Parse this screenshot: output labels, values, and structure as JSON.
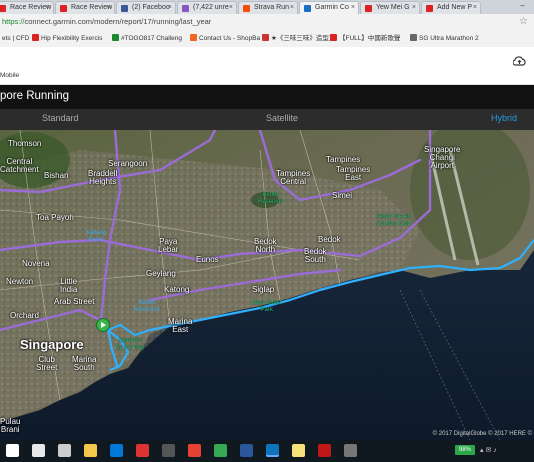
{
  "browser": {
    "tabs": [
      {
        "label": "Race Review",
        "favicon_color": "#d22"
      },
      {
        "label": "Race Review",
        "favicon_color": "#d22"
      },
      {
        "label": "(2) Faceboo",
        "favicon_color": "#3b5998"
      },
      {
        "label": "(7,422 unre",
        "favicon_color": "#8a56c2"
      },
      {
        "label": "Strava Run",
        "favicon_color": "#fc4c02"
      },
      {
        "label": "Garmin Co",
        "favicon_color": "#1a6ec0",
        "active": true
      },
      {
        "label": "Yew Mei G",
        "favicon_color": "#d22"
      },
      {
        "label": "Add New P",
        "favicon_color": "#d22"
      }
    ],
    "url_secure": "https://",
    "url_rest": "connect.garmin.com/modern/report/17/running/last_year",
    "bookmarks": [
      {
        "label": "ets | CFD",
        "icon_color": "#888"
      },
      {
        "label": "Hip Flexibility Exercis",
        "icon_color": "#d22"
      },
      {
        "label": "#TOGO817 Challeng",
        "icon_color": "#1a8a2a"
      },
      {
        "label": "Contact Us - ShopBa",
        "icon_color": "#ee6622"
      },
      {
        "label": "★《三味三味》造型正",
        "icon_color": "#c33"
      },
      {
        "label": "【FULL】中國新歌聲",
        "icon_color": "#d22"
      },
      {
        "label": "SG Ultra Marathon 2",
        "icon_color": "#666"
      }
    ]
  },
  "garmin": {
    "mobile_label": "Mobile",
    "page_title": "pore Running",
    "map_types": {
      "standard": "Standard",
      "satellite": "Satellite",
      "hybrid": "Hybrid"
    }
  },
  "map": {
    "labels": [
      {
        "id": "thomson",
        "text": "Thomson"
      },
      {
        "id": "serangoon",
        "text": "Serangoon"
      },
      {
        "id": "braddell",
        "text": "Braddell\nHeights"
      },
      {
        "id": "tampines",
        "text": "Tampines"
      },
      {
        "id": "tampines-east",
        "text": "Tampines\nEast"
      },
      {
        "id": "singapore-changi",
        "text": "Singapore\nChangi\nAirport"
      },
      {
        "id": "central",
        "text": "Central\nCatchment"
      },
      {
        "id": "bishan",
        "text": "Bishan"
      },
      {
        "id": "tampines-central",
        "text": "Tampines\nCentral"
      },
      {
        "id": "simei",
        "text": "Simei"
      },
      {
        "id": "toa-payoh",
        "text": "Toa Payoh"
      },
      {
        "id": "paya-lebar",
        "text": "Paya\nLebar"
      },
      {
        "id": "bedok-north",
        "text": "Bedok\nNorth"
      },
      {
        "id": "bedok",
        "text": "Bedok"
      },
      {
        "id": "novena",
        "text": "Novena"
      },
      {
        "id": "eunos",
        "text": "Eunos"
      },
      {
        "id": "bedok-south",
        "text": "Bedok\nSouth"
      },
      {
        "id": "geylang",
        "text": "Geylang"
      },
      {
        "id": "newton",
        "text": "Newton"
      },
      {
        "id": "little-india",
        "text": "Little\nIndia"
      },
      {
        "id": "katong",
        "text": "Katong"
      },
      {
        "id": "siglap",
        "text": "Siglap"
      },
      {
        "id": "arab-street",
        "text": "Arab Street"
      },
      {
        "id": "orchard",
        "text": "Orchard"
      },
      {
        "id": "marina",
        "text": "Marina\nEast"
      },
      {
        "id": "singapore",
        "text": "Singapore"
      },
      {
        "id": "club-street",
        "text": "Club\nStreet"
      },
      {
        "id": "marina-south",
        "text": "Marina\nSouth"
      },
      {
        "id": "pulau",
        "text": "Pulau\nBrani"
      }
    ],
    "parks": [
      {
        "id": "bedok-reservoir",
        "text": "Bedok\nReservoir"
      },
      {
        "id": "east-coast",
        "text": "East Coast\nPark"
      },
      {
        "id": "gardens",
        "text": "Gardens\nby the Bay"
      },
      {
        "id": "changi-beach",
        "text": "Tanah Merah\nCountry Club"
      }
    ],
    "waters": [
      {
        "id": "kallang",
        "text": "Kallang\nBasin"
      },
      {
        "id": "reservoir",
        "text": "Bedok\nReservoir"
      }
    ],
    "route_color": "#2fb0ff",
    "road_color": "#9b6cd6",
    "copyright": "© 2017 DigitalGlobe  © 2017 HERE  ©"
  },
  "taskbar": {
    "battery": "98%",
    "icons": [
      "start",
      "search",
      "task-view",
      "explorer",
      "store",
      "media",
      "calculator",
      "chrome-alt",
      "chrome",
      "word",
      "garmin-express",
      "notes",
      "mcafee",
      "settings"
    ]
  }
}
